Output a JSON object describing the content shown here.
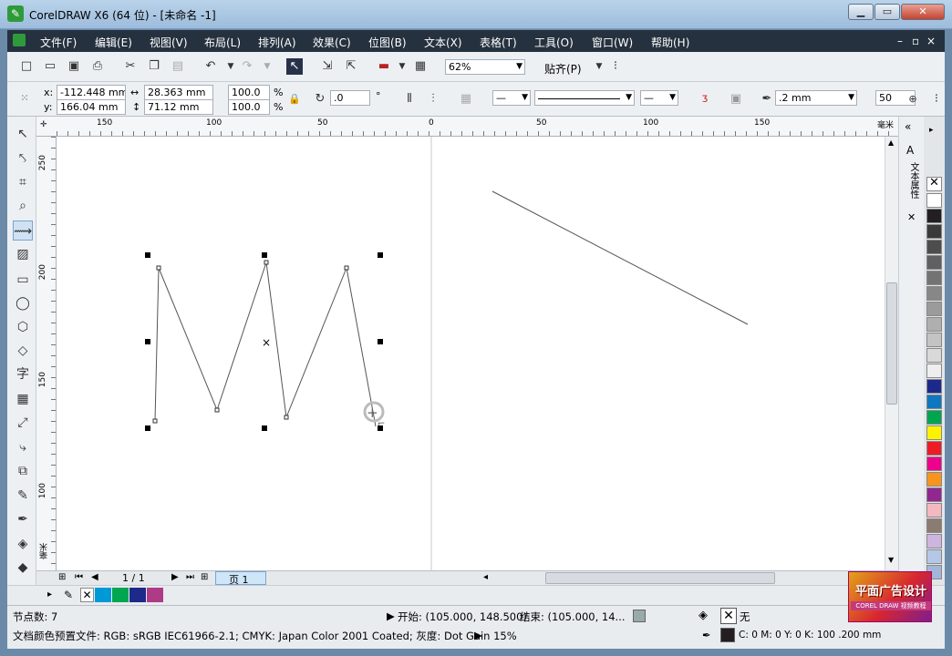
{
  "window": {
    "title": "CorelDRAW X6 (64 位) - [未命名 -1]",
    "min_label": "▁",
    "max_label": "▭",
    "close_label": "✕"
  },
  "menu": [
    "文件(F)",
    "编辑(E)",
    "视图(V)",
    "布局(L)",
    "排列(A)",
    "效果(C)",
    "位图(B)",
    "文本(X)",
    "表格(T)",
    "工具(O)",
    "窗口(W)",
    "帮助(H)"
  ],
  "menu_positions_note": "",
  "toolbar": {
    "zoom": "62%",
    "snap": "贴齐(P)"
  },
  "property_bar": {
    "x_label": "x:",
    "x": "-112.448 mm",
    "y_label": "y:",
    "y": "166.04 mm",
    "w": "28.363 mm",
    "h": "71.12 mm",
    "scale_x": "100.0",
    "scale_y": "100.0",
    "percent": "%",
    "angle": ".0",
    "degree": "°",
    "outline_width": ".2 mm",
    "nudge": "50"
  },
  "rulers": {
    "h_labels": [
      "150",
      "100",
      "50",
      "0",
      "50",
      "100",
      "150"
    ],
    "h_unit": "毫米",
    "v_labels": [
      "250",
      "200",
      "150",
      "100"
    ],
    "v_unit": "毫米"
  },
  "docker": {
    "title": "文本属性"
  },
  "page_nav": {
    "counter": "1 / 1",
    "tab": "页 1"
  },
  "palette_colors": [
    "#ffffff",
    "#231f20",
    "#3a3a3a",
    "#4d4d4d",
    "#606060",
    "#737373",
    "#878787",
    "#9b9b9b",
    "#afafaf",
    "#c4c4c4",
    "#d9d9d9",
    "#eeeeee",
    "#1b2a8a",
    "#0f76c0",
    "#00a64f",
    "#fff200",
    "#ed1c24",
    "#ec008c",
    "#f7941d",
    "#92278f",
    "#f4b8c1",
    "#8c7b70",
    "#cdb5e0",
    "#b5c7e6",
    "#a3b6d9"
  ],
  "doc_palette_colors": [
    "#0099d8",
    "#00a650",
    "#1d2a8a",
    "#ae3b86"
  ],
  "status": {
    "nodes": "节点数: 7",
    "start": "开始: (105.000, 148.500)",
    "end": "结束: (105.000, 14...",
    "fill_none": "无",
    "color_profile": "文档颜色预置文件: RGB: sRGB IEC61966-2.1; CMYK: Japan Color 2001 Coated; 灰度: Dot Gain 15%",
    "outline": "C: 0 M: 0 Y: 0 K: 100  .200 mm"
  },
  "logo": {
    "text": "平面广告设计",
    "sub": "COREL DRAW 视频教程"
  }
}
